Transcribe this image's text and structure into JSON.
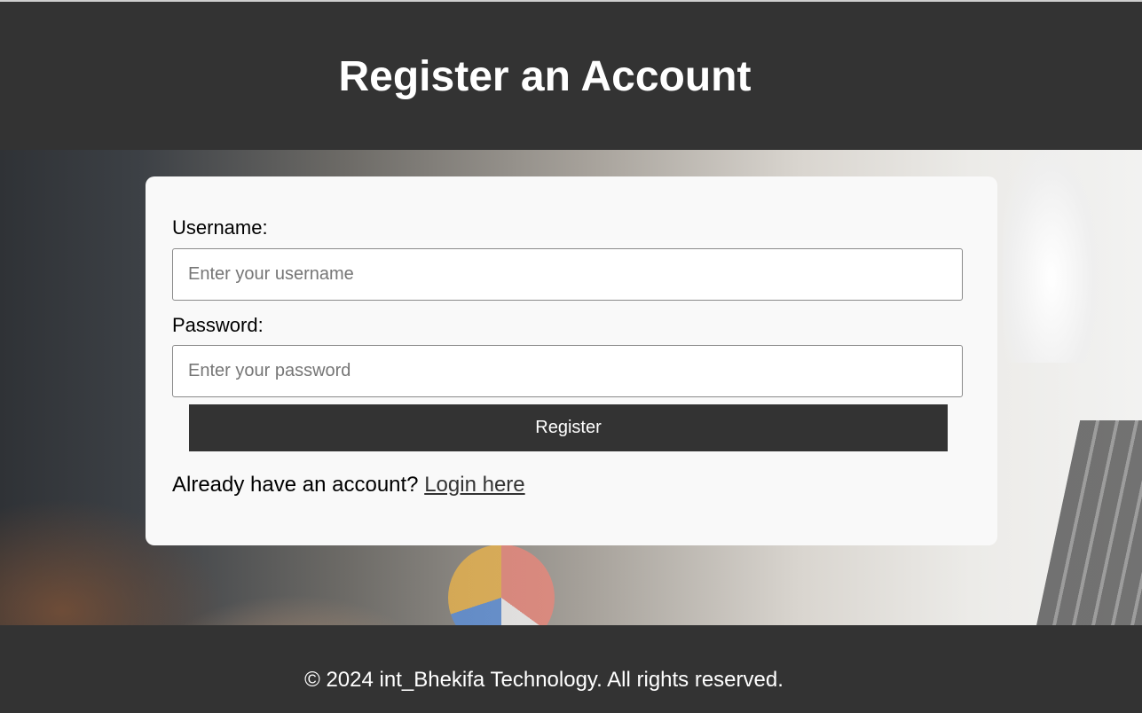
{
  "header": {
    "title": "Register an Account"
  },
  "form": {
    "username_label": "Username:",
    "username_placeholder": "Enter your username",
    "username_value": "",
    "password_label": "Password:",
    "password_placeholder": "Enter your password",
    "password_value": "",
    "submit_label": "Register",
    "login_prompt": "Already have an account?",
    "login_link": "Login here"
  },
  "footer": {
    "text": "© 2024 int_Bhekifa Technology. All rights reserved."
  },
  "colors": {
    "header_bg": "#333333",
    "card_bg": "#f9f9f9",
    "button_bg": "#333333",
    "button_text": "#ffffff"
  }
}
